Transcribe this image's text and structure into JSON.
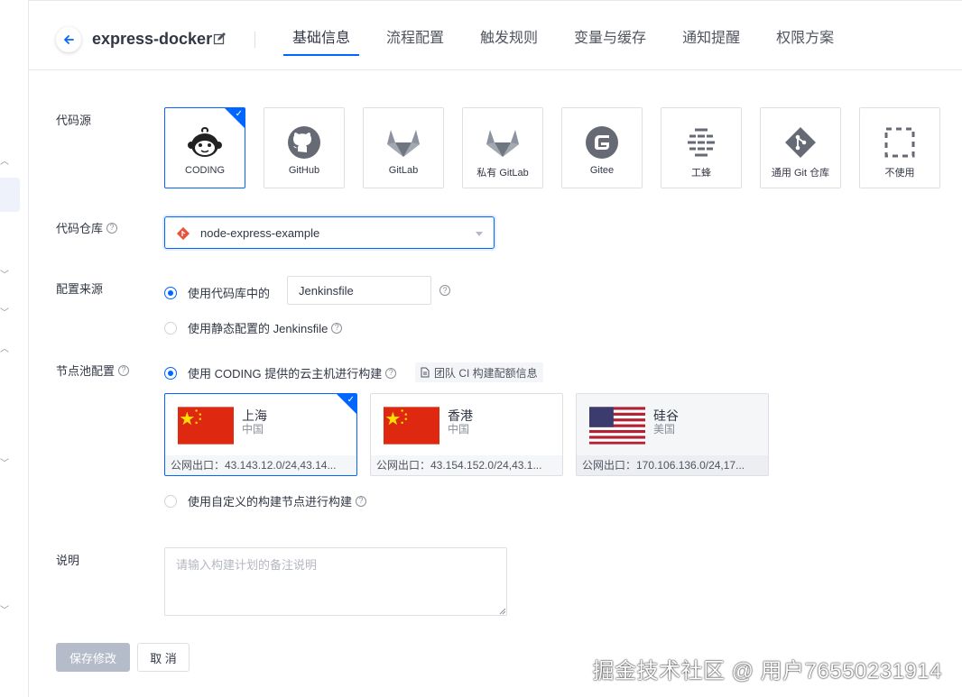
{
  "header": {
    "project_name": "express-docker",
    "tabs": [
      {
        "label": "基础信息",
        "active": true
      },
      {
        "label": "流程配置",
        "active": false
      },
      {
        "label": "触发规则",
        "active": false
      },
      {
        "label": "变量与缓存",
        "active": false
      },
      {
        "label": "通知提醒",
        "active": false
      },
      {
        "label": "权限方案",
        "active": false
      }
    ]
  },
  "code_source": {
    "label": "代码源",
    "selected": "CODING",
    "options": [
      {
        "name": "CODING",
        "icon": "coding-monkey-icon"
      },
      {
        "name": "GitHub",
        "icon": "github-icon"
      },
      {
        "name": "GitLab",
        "icon": "gitlab-icon"
      },
      {
        "name": "私有 GitLab",
        "icon": "gitlab-icon"
      },
      {
        "name": "Gitee",
        "icon": "gitee-icon"
      },
      {
        "name": "工蜂",
        "icon": "gongfeng-icon"
      },
      {
        "name": "通用 Git 仓库",
        "icon": "git-icon"
      },
      {
        "name": "不使用",
        "icon": "dashed-square-icon"
      }
    ]
  },
  "repo": {
    "label": "代码仓库",
    "value": "node-express-example"
  },
  "config_source": {
    "label": "配置来源",
    "option_repo": "使用代码库中的",
    "jenkinsfile_value": "Jenkinsfile",
    "option_static": "使用静态配置的 Jenkinsfile",
    "selected": "repo"
  },
  "node_pool": {
    "label": "节点池配置",
    "option_cloud": "使用 CODING 提供的云主机进行构建",
    "quota_link": "团队 CI 构建配额信息",
    "option_custom": "使用自定义的构建节点进行构建",
    "regions": [
      {
        "name": "上海",
        "country": "中国",
        "ip": "公网出口：43.143.12.0/24,43.14...",
        "selected": true,
        "flag": "china-flag"
      },
      {
        "name": "香港",
        "country": "中国",
        "ip": "公网出口：43.154.152.0/24,43.1...",
        "selected": false,
        "flag": "china-flag"
      },
      {
        "name": "硅谷",
        "country": "美国",
        "ip": "公网出口：170.106.136.0/24,17...",
        "selected": false,
        "flag": "usa-flag"
      }
    ]
  },
  "description": {
    "label": "说明",
    "placeholder": "请输入构建计划的备注说明"
  },
  "actions": {
    "save": "保存修改",
    "cancel": "取 消"
  },
  "watermark": "掘金技术社区 @ 用户76550231914",
  "colors": {
    "accent": "#0066ff",
    "save_disabled": "#b4bcc9"
  }
}
